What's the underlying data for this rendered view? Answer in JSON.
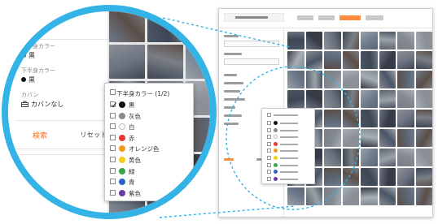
{
  "filter_form": {
    "upper_color_label": "上半身カラー",
    "upper_color_value": "黒",
    "lower_color_label": "下半身カラー",
    "lower_color_value": "黒",
    "bag_label": "カバン",
    "bag_value": "カバンなし",
    "search_button": "検索",
    "reset_button": "リセット"
  },
  "color_popup": {
    "title": "下半身カラー (1/2)",
    "options": [
      {
        "label": "黒",
        "color": "#111111",
        "checked": true
      },
      {
        "label": "灰色",
        "color": "#8a8a8a",
        "checked": false
      },
      {
        "label": "白",
        "color": "#ffffff",
        "checked": false
      },
      {
        "label": "赤",
        "color": "#e23b2e",
        "checked": false
      },
      {
        "label": "オレンジ色",
        "color": "#f39a1e",
        "checked": false
      },
      {
        "label": "黄色",
        "color": "#f2cf1f",
        "checked": false
      },
      {
        "label": "緑",
        "color": "#3aa447",
        "checked": false
      },
      {
        "label": "青",
        "color": "#2c63c4",
        "checked": false
      },
      {
        "label": "紫色",
        "color": "#6a3aa8",
        "checked": false
      }
    ]
  },
  "icons": {
    "bag_icon": "bag-icon",
    "check_icon": "checkmark"
  },
  "accent_colors": {
    "zoom_ring": "#33b3e6",
    "search_button_text": "#ff6a13"
  }
}
